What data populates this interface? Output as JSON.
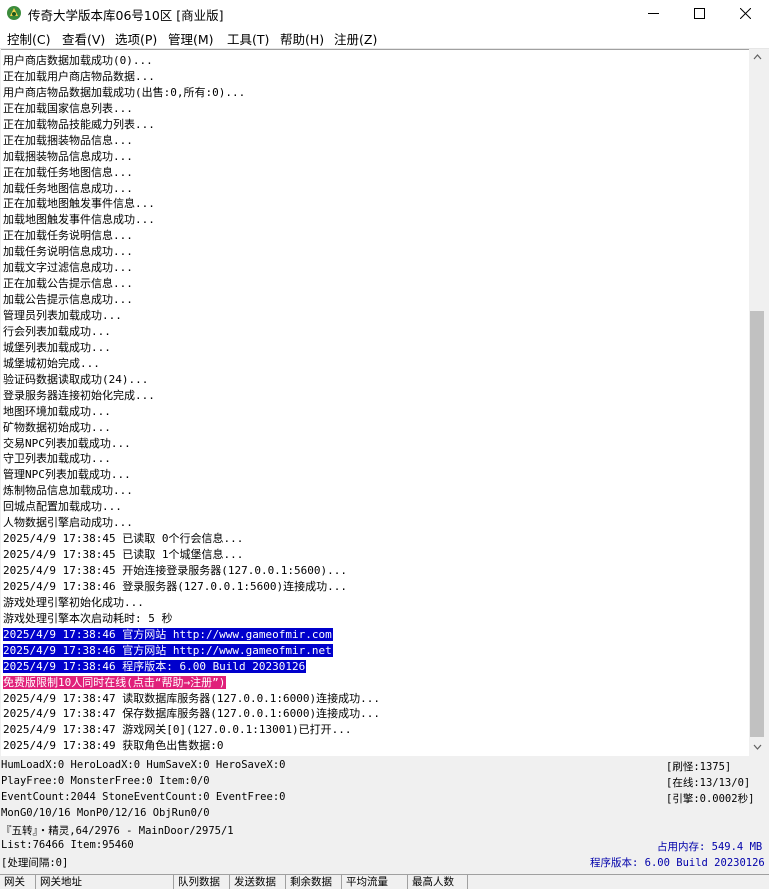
{
  "window": {
    "title": "传奇大学版本库06号10区 [商业版]"
  },
  "menu": [
    "控制(C)",
    "查看(V)",
    "选项(P)",
    "管理(M)",
    "工具(T)",
    "帮助(H)",
    "注册(Z)"
  ],
  "log": [
    {
      "text": "用户商店数据加载成功(0)..."
    },
    {
      "text": "正在加载用户商店物品数据..."
    },
    {
      "text": "用户商店物品数据加载成功(出售:0,所有:0)..."
    },
    {
      "text": "正在加载国家信息列表..."
    },
    {
      "text": "正在加载物品技能威力列表..."
    },
    {
      "text": "正在加载捆装物品信息..."
    },
    {
      "text": "加载捆装物品信息成功..."
    },
    {
      "text": "正在加载任务地图信息..."
    },
    {
      "text": "加载任务地图信息成功..."
    },
    {
      "text": "正在加载地图触发事件信息..."
    },
    {
      "text": "加载地图触发事件信息成功..."
    },
    {
      "text": "正在加载任务说明信息..."
    },
    {
      "text": "加载任务说明信息成功..."
    },
    {
      "text": "加载文字过滤信息成功..."
    },
    {
      "text": "正在加载公告提示信息..."
    },
    {
      "text": "加载公告提示信息成功..."
    },
    {
      "text": "管理员列表加载成功..."
    },
    {
      "text": "行会列表加载成功..."
    },
    {
      "text": "城堡列表加载成功..."
    },
    {
      "text": "城堡城初始完成..."
    },
    {
      "text": "验证码数据读取成功(24)..."
    },
    {
      "text": "登录服务器连接初始化完成..."
    },
    {
      "text": "地图环境加载成功..."
    },
    {
      "text": "矿物数据初始成功..."
    },
    {
      "text": "交易NPC列表加载成功..."
    },
    {
      "text": "守卫列表加载成功..."
    },
    {
      "text": "管理NPC列表加载成功..."
    },
    {
      "text": "炼制物品信息加载成功..."
    },
    {
      "text": "回城点配置加载成功..."
    },
    {
      "text": "人物数据引擎启动成功..."
    },
    {
      "text": "2025/4/9 17:38:45 已读取 0个行会信息..."
    },
    {
      "text": "2025/4/9 17:38:45 已读取 1个城堡信息..."
    },
    {
      "text": "2025/4/9 17:38:45 开始连接登录服务器(127.0.0.1:5600)..."
    },
    {
      "text": "2025/4/9 17:38:46 登录服务器(127.0.0.1:5600)连接成功..."
    },
    {
      "text": "游戏处理引擎初始化成功..."
    },
    {
      "text": "游戏处理引擎本次启动耗时: 5 秒"
    },
    {
      "text": "2025/4/9 17:38:46 官方网站 http://www.gameofmir.com",
      "hl": "blue"
    },
    {
      "text": "2025/4/9 17:38:46 官方网站 http://www.gameofmir.net",
      "hl": "blue"
    },
    {
      "text": "2025/4/9 17:38:46 程序版本: 6.00 Build 20230126",
      "hl": "blue"
    },
    {
      "text": "免费版限制10人同时在线(点击“帮助→注册”)",
      "hl": "pink"
    },
    {
      "text": "2025/4/9 17:38:47 读取数据库服务器(127.0.0.1:6000)连接成功..."
    },
    {
      "text": "2025/4/9 17:38:47 保存数据库服务器(127.0.0.1:6000)连接成功..."
    },
    {
      "text": "2025/4/9 17:38:47 游戏网关[0](127.0.0.1:13001)已打开..."
    },
    {
      "text": "2025/4/9 17:38:49 获取角色出售数据:0"
    }
  ],
  "status": {
    "line1": "HumLoadX:0 HeroLoadX:0 HumSaveX:0 HeroSaveX:0",
    "line2": "PlayFree:0 MonsterFree:0 Item:0/0",
    "line3": "EventCount:2044 StoneEventCount:0 EventFree:0",
    "line4": "MonG0/10/16 MonP0/12/16 ObjRun0/0",
    "line5": "『五转』・精灵,64/2976 - MainDoor/2975/1",
    "line6": "List:76466 Item:95460",
    "line7": "[处理间隔:0]",
    "right1": "[刷怪:1375]",
    "right2": "[在线:13/13/0]",
    "right3": "[引擎:0.0002秒]",
    "memory": "占用内存: 549.4 MB",
    "version": "程序版本: 6.00 Build 20230126"
  },
  "columns": [
    "网关",
    "网关地址",
    "队列数据",
    "发送数据",
    "剩余数据",
    "平均流量",
    "最高人数"
  ],
  "colors": {
    "highlight_blue": "#0000cc",
    "highlight_pink": "#e0207a",
    "status_blue": "#0000aa"
  }
}
